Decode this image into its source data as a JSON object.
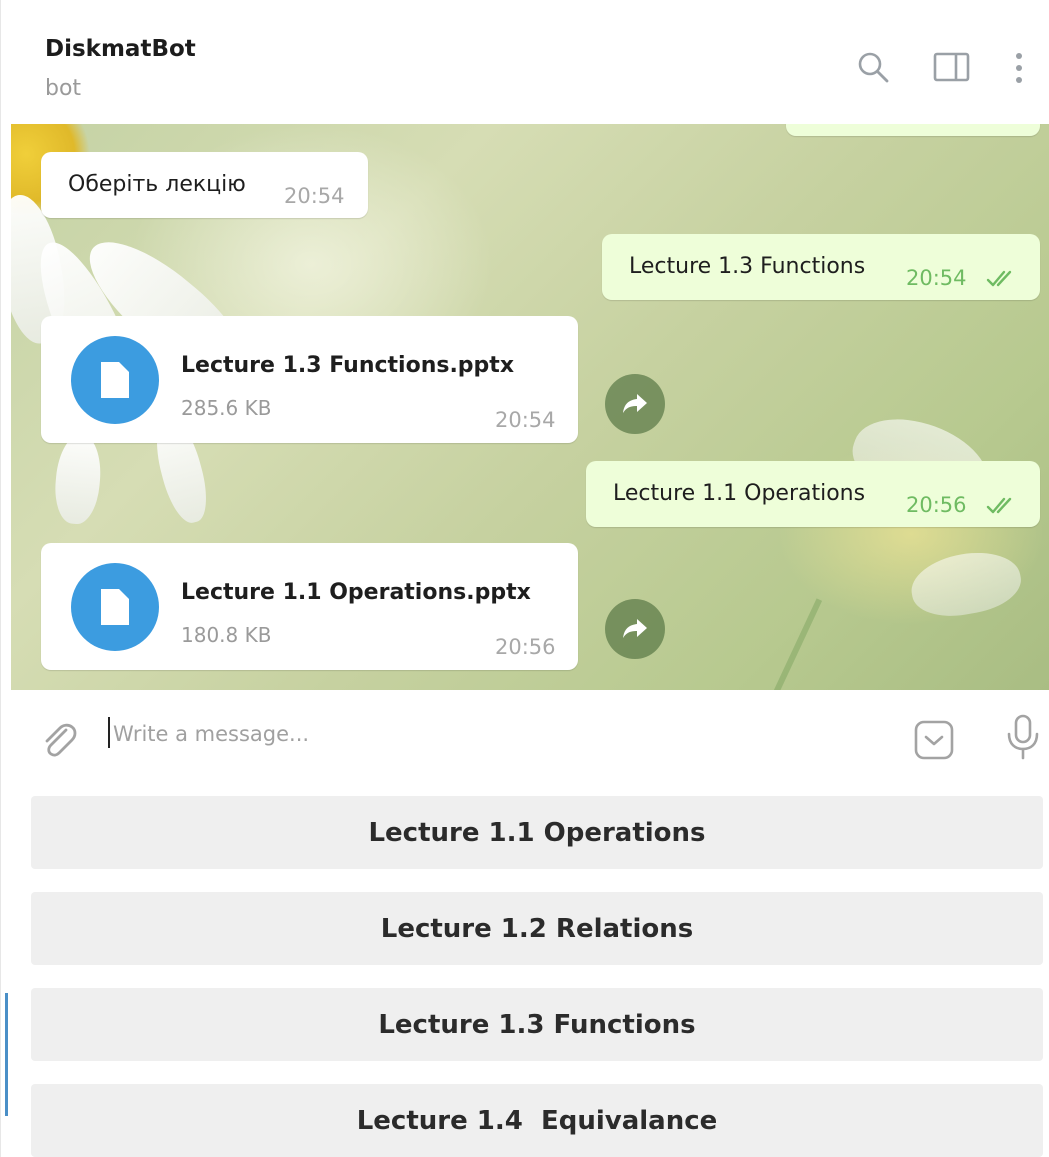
{
  "header": {
    "title": "DiskmatBot",
    "status": "bot",
    "icons": [
      "search-icon",
      "sidebar-toggle-icon",
      "more-vertical-icon"
    ]
  },
  "messages": [
    {
      "direction": "in",
      "type": "text",
      "text": "Оберіть лекцію",
      "time": "20:54"
    },
    {
      "direction": "out",
      "type": "text",
      "text": "Lecture 1.3 Functions",
      "time": "20:54",
      "status": "read"
    },
    {
      "direction": "in",
      "type": "file",
      "file_name": "Lecture 1.3 Functions.pptx",
      "size": "285.6 KB",
      "time": "20:54"
    },
    {
      "direction": "out",
      "type": "text",
      "text": "Lecture 1.1 Operations",
      "time": "20:56",
      "status": "read"
    },
    {
      "direction": "in",
      "type": "file",
      "file_name": "Lecture 1.1 Operations.pptx",
      "size": "180.8 KB",
      "time": "20:56"
    }
  ],
  "composer": {
    "placeholder": "Write a message...",
    "value": ""
  },
  "keyboard": {
    "buttons": [
      {
        "label": "Lecture 1.1 Operations"
      },
      {
        "label": "Lecture 1.2 Relations"
      },
      {
        "label": "Lecture 1.3 Functions"
      },
      {
        "label": "Lecture 1.4  Equivalance"
      }
    ]
  },
  "colors": {
    "outgoing_bubble": "#eefed9",
    "read_check": "#6fbb62",
    "file_icon": "#3c9ce0",
    "keyboard_button": "#efefef"
  }
}
